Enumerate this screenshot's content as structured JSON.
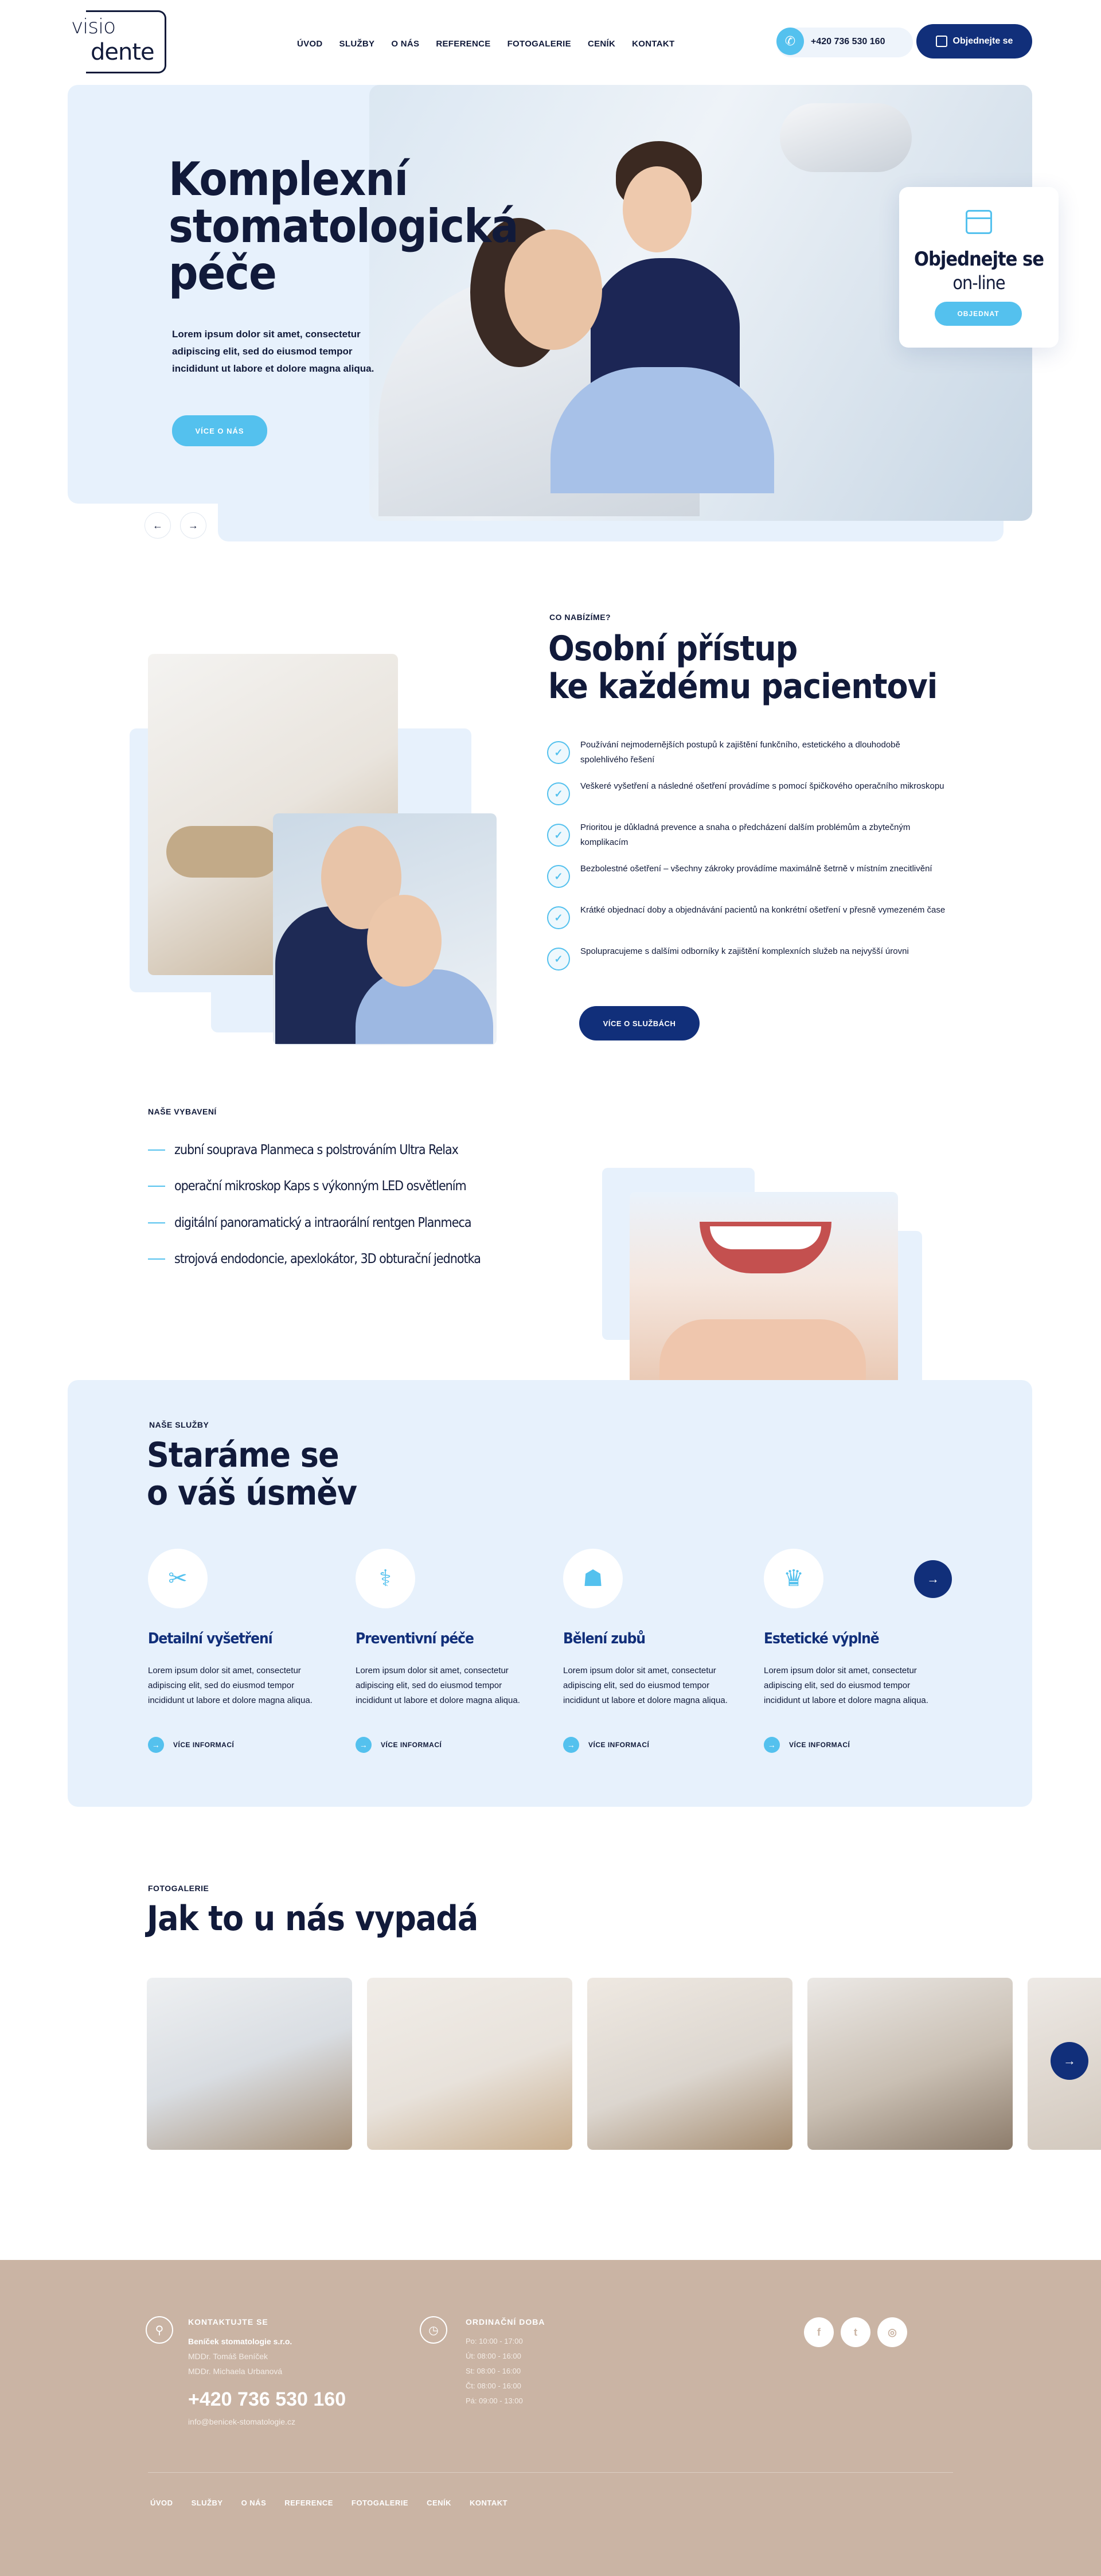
{
  "brand": {
    "line1": "visio",
    "line2": "dente"
  },
  "nav": [
    "ÚVOD",
    "SLUŽBY",
    "O NÁS",
    "REFERENCE",
    "FOTOGALERIE",
    "CENÍK",
    "KONTAKT"
  ],
  "header": {
    "phone": "+420 736 530 160",
    "order_button": "Objednejte se"
  },
  "hero": {
    "title_lines": [
      "Komplexní",
      "stomatologická",
      "péče"
    ],
    "text": "Lorem ipsum dolor sit amet, consectetur adipiscing elit, sed do eiusmod tempor incididunt ut labore et dolore magna aliqua.",
    "button": "VÍCE O NÁS",
    "prev_arrow": "←",
    "next_arrow": "→"
  },
  "online_card": {
    "title": "Objednejte se",
    "subtitle": "on-line",
    "button": "OBJEDNAT"
  },
  "offer": {
    "kicker": "CO NABÍZÍME?",
    "title_lines": [
      "Osobní přístup",
      "ke každému pacientovi"
    ],
    "items": [
      "Používání nejmodernějších postupů k zajištění funkčního, estetického a dlouhodobě spolehlivého řešení",
      "Veškeré vyšetření a následné ošetření provádíme s pomocí špičkového operačního mikroskopu",
      "Prioritou je důkladná prevence a snaha o předcházení dalším problémům a zbytečným komplikacím",
      "Bezbolestné ošetření – všechny zákroky provádíme maximálně šetrně v místním znecitlivění",
      "Krátké objednací doby a objednávání pacientů na konkrétní ošetření v přesně vymezeném čase",
      "Spolupracujeme s dalšími odborníky k zajištění komplexních služeb na nejvyšší úrovni"
    ],
    "button": "VÍCE O SLUŽBÁCH"
  },
  "equipment": {
    "kicker": "NAŠE VYBAVENÍ",
    "items": [
      "zubní souprava Planmeca s polstrováním Ultra Relax",
      "operační mikroskop Kaps s výkonným LED osvětlením",
      "digitální panoramatický a intraorální rentgen Planmeca",
      "strojová endodoncie, apexlokátor, 3D obturační jednotka"
    ]
  },
  "services": {
    "kicker": "NAŠE SLUŽBY",
    "title_lines": [
      "Staráme se",
      "o váš úsměv"
    ],
    "items": [
      {
        "name": "Detailní vyšetření",
        "icon": "tools-icon",
        "text": "Lorem ipsum dolor sit amet, consectetur adipiscing elit, sed do eiusmod tempor incididunt ut labore et dolore magna aliqua.",
        "more": "VÍCE INFORMACÍ"
      },
      {
        "name": "Preventivní péče",
        "icon": "tooth-brush-icon",
        "text": "Lorem ipsum dolor sit amet, consectetur adipiscing elit, sed do eiusmod tempor incididunt ut labore et dolore magna aliqua.",
        "more": "VÍCE INFORMACÍ"
      },
      {
        "name": "Bělení zubů",
        "icon": "tooth-icon",
        "text": "Lorem ipsum dolor sit amet, consectetur adipiscing elit, sed do eiusmod tempor incididunt ut labore et dolore magna aliqua.",
        "more": "VÍCE INFORMACÍ"
      },
      {
        "name": "Estetické výplně",
        "icon": "crown-tooth-icon",
        "text": "Lorem ipsum dolor sit amet, consectetur adipiscing elit, sed do eiusmod tempor incididunt ut labore et dolore magna aliqua.",
        "more": "VÍCE INFORMACÍ"
      }
    ],
    "next_arrow": "→"
  },
  "gallery": {
    "kicker": "FOTOGALERIE",
    "title": "Jak to u nás vypadá",
    "next_arrow": "→"
  },
  "footer": {
    "contact_head": "KONTAKTUJTE SE",
    "company": "Beníček stomatologie s.r.o.",
    "person1": "MDDr. Tomáš Beníček",
    "person2": "MDDr. Michaela Urbanová",
    "phone": "+420 736 530 160",
    "email": "info@benicek-stomatologie.cz",
    "hours_head": "ORDINAČNÍ DOBA",
    "hours": [
      "Po:  10:00 - 17:00",
      "Út:  08:00 - 16:00",
      "St:  08:00 - 16:00",
      "Čt:  08:00 - 16:00",
      "Pá:  09:00 - 13:00"
    ],
    "social": [
      "f",
      "t",
      "◎"
    ],
    "nav": [
      "ÚVOD",
      "SLUŽBY",
      "O NÁS",
      "REFERENCE",
      "FOTOGALERIE",
      "CENÍK",
      "KONTAKT"
    ]
  },
  "colors": {
    "navy": "#112f7a",
    "accent": "#54c1ee",
    "light_blue": "#e7f1fc",
    "footer": "#cab4a4"
  }
}
